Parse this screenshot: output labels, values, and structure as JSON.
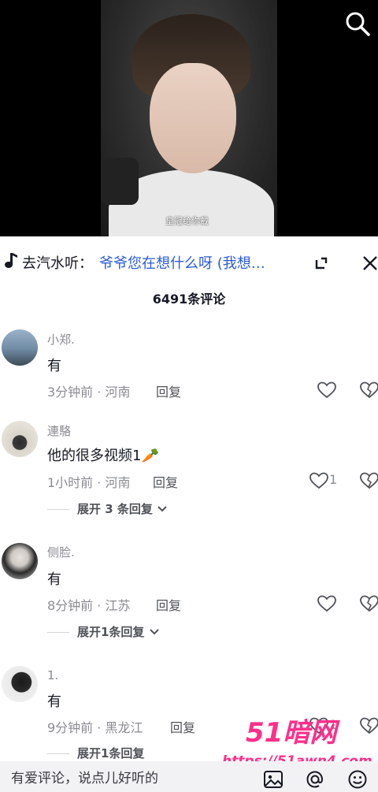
{
  "video": {
    "caption": "皇冠给你戴"
  },
  "music": {
    "prefix": "去汽水听：",
    "title": "爷爷您在想什么呀 (我想…"
  },
  "comments_count": "6491条评论",
  "comments": [
    {
      "user": "小郑.",
      "text": "有",
      "time_loc": "3分钟前 · 河南",
      "reply": "回复",
      "likes": ""
    },
    {
      "user": "連駱",
      "text": "他的很多视频1🥕",
      "time_loc": "1小时前 · 河南",
      "reply": "回复",
      "likes": "1",
      "expand": "展开 3 条回复"
    },
    {
      "user": "侧脸.",
      "text": "有",
      "time_loc": "8分钟前 · 江苏",
      "reply": "回复",
      "likes": "",
      "expand": "展开1条回复"
    },
    {
      "user": "1.",
      "text": "有",
      "time_loc": "9分钟前 · 黑龙江",
      "reply": "回复",
      "likes": "1",
      "expand": "展开1条回复"
    }
  ],
  "watermark": {
    "logo": "51暗网",
    "url": "https://51awn4.com"
  },
  "input": {
    "placeholder": "有爱评论，说点儿好听的"
  },
  "icons": [
    "search-icon",
    "music-note-icon",
    "expand-icon",
    "close-icon",
    "heart-icon",
    "broken-heart-icon",
    "image-icon",
    "at-icon",
    "emoji-icon",
    "chevron-down-icon"
  ]
}
